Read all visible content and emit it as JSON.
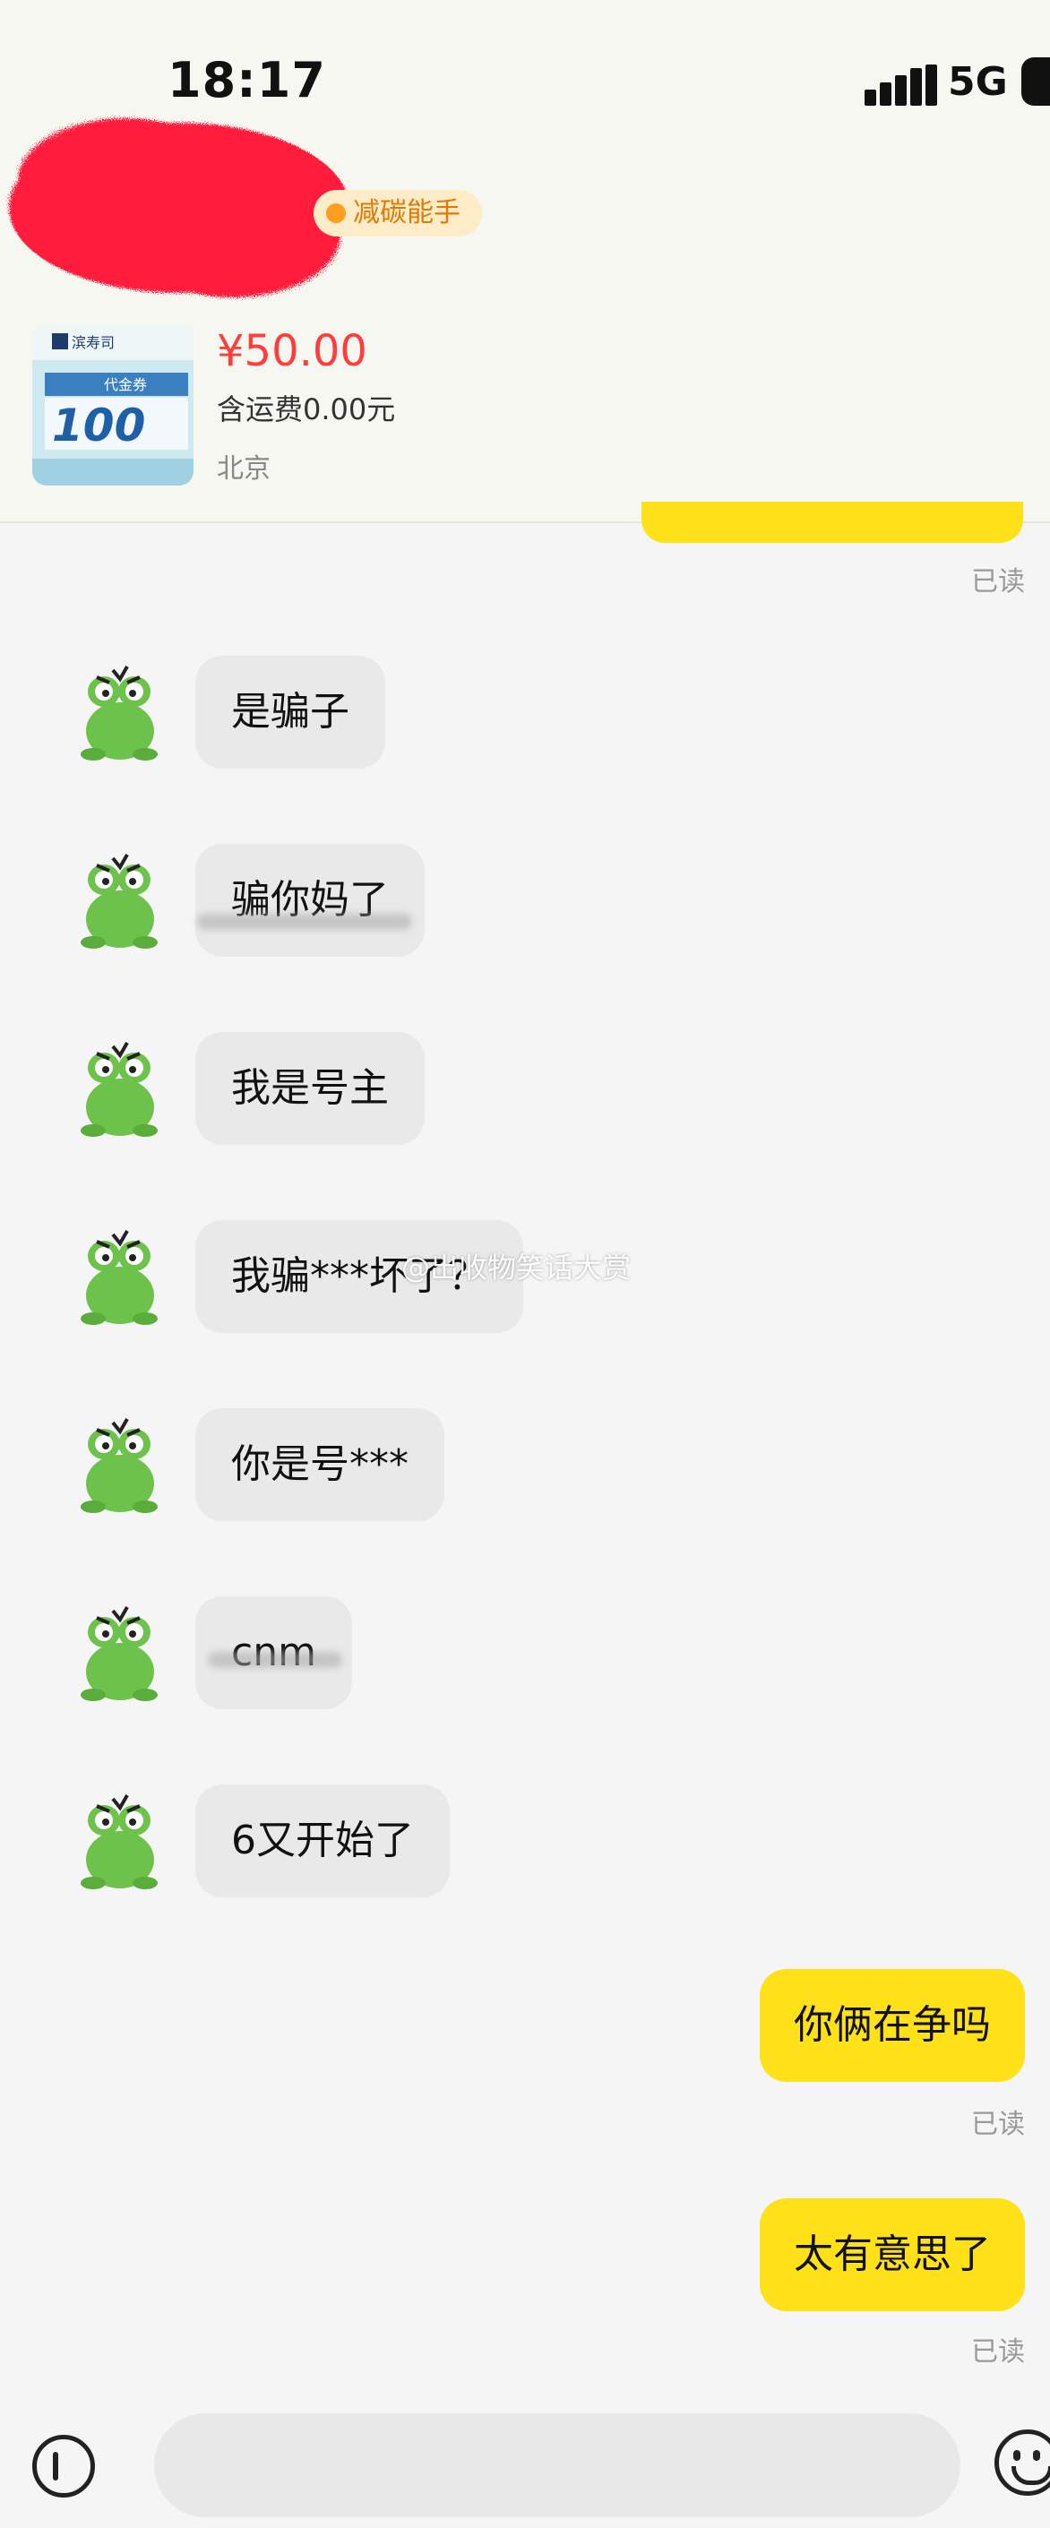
{
  "status_bar": {
    "time": "18:17",
    "network": "5G"
  },
  "header": {
    "badge": "减碳能手",
    "product": {
      "thumb_brand": "滨寿司",
      "thumb_label": "代金券",
      "thumb_value": "100",
      "price": "¥50.00",
      "shipping": "含运费0.00元",
      "location": "北京"
    }
  },
  "messages": [
    {
      "side": "in",
      "text": "是骗子"
    },
    {
      "side": "in",
      "text": "骗你妈了"
    },
    {
      "side": "in",
      "text": "我是号主"
    },
    {
      "side": "in",
      "text": "我骗***坏了？"
    },
    {
      "side": "in",
      "text": "你是号***"
    },
    {
      "side": "in",
      "text": "cnm"
    },
    {
      "side": "in",
      "text": "6又开始了"
    },
    {
      "side": "out",
      "text": "你俩在争吗",
      "status": "已读"
    },
    {
      "side": "out",
      "text": "太有意思了",
      "status": "已读"
    }
  ],
  "read_label": "已读",
  "watermark": "@出收物笑话大赏",
  "input": {
    "placeholder": ""
  },
  "colors": {
    "outgoing_bubble": "#ffe11a",
    "incoming_bubble": "#e9e9e9",
    "price": "#ff3d3d",
    "badge_text": "#e07a00"
  }
}
